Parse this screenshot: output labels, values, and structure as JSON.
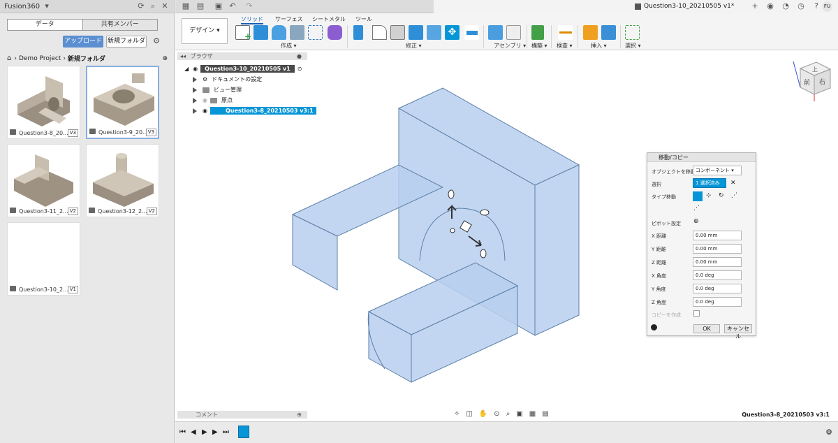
{
  "left_panel": {
    "app_name": "Fusion360",
    "tabs": [
      "データ",
      "共有メンバー"
    ],
    "upload_label": "アップロード",
    "new_folder_label": "新規フォルダ",
    "breadcrumb": [
      "Demo Project",
      "新規フォルダ"
    ],
    "files": [
      {
        "name": "Question3-8_20...",
        "version": "V3"
      },
      {
        "name": "Question3-9_20...",
        "version": "V3"
      },
      {
        "name": "Question3-11_2...",
        "version": "V2"
      },
      {
        "name": "Question3-12_2...",
        "version": "V2"
      },
      {
        "name": "Question3-10_2...",
        "version": "V1"
      }
    ]
  },
  "document_tab": {
    "title": "Question3-10_20210505 v1*"
  },
  "user_initials": "FU",
  "ribbon": {
    "workspace_label": "デザイン",
    "tabs": [
      "ソリッド",
      "サーフェス",
      "シートメタル",
      "ツール"
    ],
    "groups": [
      "作成",
      "修正",
      "アセンブリ",
      "構築",
      "検査",
      "挿入",
      "選択"
    ]
  },
  "browser": {
    "title": "ブラウザ",
    "root": "Question3-10_20210505 v1",
    "items": [
      "ドキュメントの設定",
      "ビュー管理",
      "原点",
      "Question3-8_20210503 v3:1"
    ]
  },
  "viewcube": {
    "front": "前",
    "right": "右",
    "top": "上"
  },
  "move_dialog": {
    "title": "移動/コピー",
    "rows": [
      {
        "label": "オブジェクトを移動",
        "value": "コンポーネント"
      },
      {
        "label": "選択",
        "value": "1 選択済み"
      },
      {
        "label": "タイプ移動",
        "value": ""
      },
      {
        "label": "ピボット設定",
        "value": ""
      },
      {
        "label": "X 距離",
        "value": "0.00 mm"
      },
      {
        "label": "Y 距離",
        "value": "0.00 mm"
      },
      {
        "label": "Z 距離",
        "value": "0.00 mm"
      },
      {
        "label": "X 角度",
        "value": "0.0 deg"
      },
      {
        "label": "Y 角度",
        "value": "0.0 deg"
      },
      {
        "label": "Z 角度",
        "value": "0.0 deg"
      },
      {
        "label": "コピーを作成",
        "value": ""
      }
    ],
    "ok_label": "OK",
    "cancel_label": "キャンセル"
  },
  "comments_label": "コメント",
  "status_text": "Question3-8_20210503 v3:1",
  "accent_color": "#0696d7"
}
